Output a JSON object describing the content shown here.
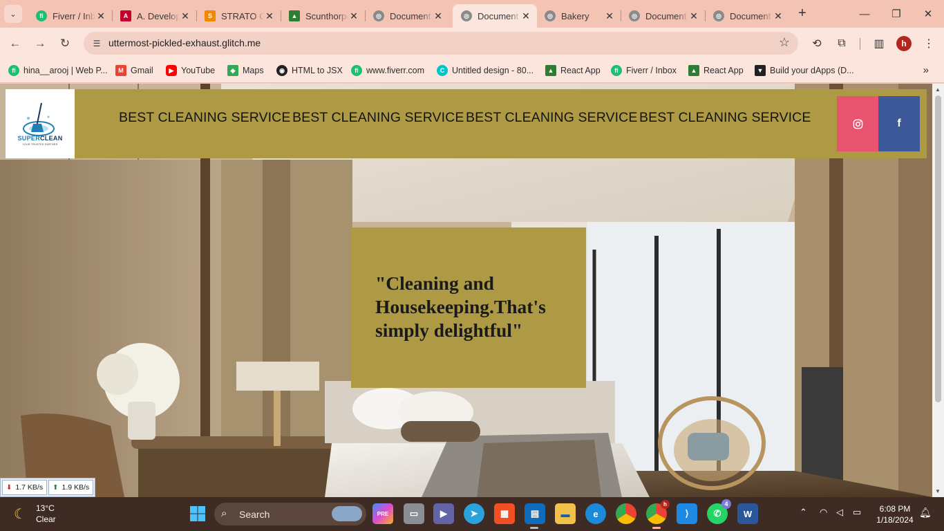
{
  "browser": {
    "tabs": [
      {
        "title": "Fiverr / Inbox",
        "favicon_color": "#1dbf73",
        "favicon_glyph": "fi"
      },
      {
        "title": "A. Developer",
        "favicon_color": "#c3002f",
        "favicon_glyph": "A"
      },
      {
        "title": "STRATO Control",
        "favicon_color": "#f18a00",
        "favicon_glyph": "S"
      },
      {
        "title": "Scunthorpe",
        "favicon_color": "#2e7d32",
        "favicon_glyph": "▲"
      },
      {
        "title": "Document",
        "favicon_color": "#8a8a8a",
        "favicon_glyph": "◎"
      },
      {
        "title": "Document",
        "favicon_color": "#8a8a8a",
        "favicon_glyph": "◎"
      },
      {
        "title": "Bakery",
        "favicon_color": "#8a8a8a",
        "favicon_glyph": "◎"
      },
      {
        "title": "Document",
        "favicon_color": "#8a8a8a",
        "favicon_glyph": "◎"
      },
      {
        "title": "Document",
        "favicon_color": "#8a8a8a",
        "favicon_glyph": "◎"
      }
    ],
    "active_tab_index": 5,
    "url": "uttermost-pickled-exhaust.glitch.me",
    "profile_initial": "h",
    "bookmarks": [
      {
        "label": "hina__arooj | Web P...",
        "icon_color": "#1dbf73",
        "icon_glyph": "fi"
      },
      {
        "label": "Gmail",
        "icon_color": "#ea4335",
        "icon_glyph": "M"
      },
      {
        "label": "YouTube",
        "icon_color": "#ff0000",
        "icon_glyph": "▶"
      },
      {
        "label": "Maps",
        "icon_color": "#34a853",
        "icon_glyph": "◆"
      },
      {
        "label": "HTML to JSX",
        "icon_color": "#222222",
        "icon_glyph": "◉"
      },
      {
        "label": "www.fiverr.com",
        "icon_color": "#1dbf73",
        "icon_glyph": "fi"
      },
      {
        "label": "Untitled design - 80...",
        "icon_color": "#00c4cc",
        "icon_glyph": "C"
      },
      {
        "label": "React App",
        "icon_color": "#2e7d32",
        "icon_glyph": "▲"
      },
      {
        "label": "Fiverr / Inbox",
        "icon_color": "#1dbf73",
        "icon_glyph": "fi"
      },
      {
        "label": "React App",
        "icon_color": "#2e7d32",
        "icon_glyph": "▲"
      },
      {
        "label": "Build your dApps (D...",
        "icon_color": "#222222",
        "icon_glyph": "▼"
      }
    ]
  },
  "site": {
    "logo": {
      "word_a": "SUPER",
      "word_b": "CLEAN",
      "tagline": "YOUR TRUSTED PARTNER"
    },
    "nav": [
      "BEST CLEANING SERVICE",
      "BEST CLEANING SERVICE",
      "BEST CLEANING SERVICE",
      "BEST CLEANING SERVICE"
    ],
    "social": {
      "instagram": "◎",
      "facebook": "f"
    },
    "quote": "\"Cleaning and Housekeeping.That's simply delightful\"",
    "colors": {
      "header_bg": "#ae9a45",
      "instagram": "#e8536f",
      "facebook": "#3b5999"
    }
  },
  "netspeed": {
    "down": "1.7 KB/s",
    "up": "1.9 KB/s"
  },
  "taskbar": {
    "weather_temp": "13°C",
    "weather_desc": "Clear",
    "search_placeholder": "Search",
    "time": "6:08 PM",
    "date": "1/18/2024",
    "whatsapp_badge": "4",
    "chrome_profile_badge": "h"
  }
}
